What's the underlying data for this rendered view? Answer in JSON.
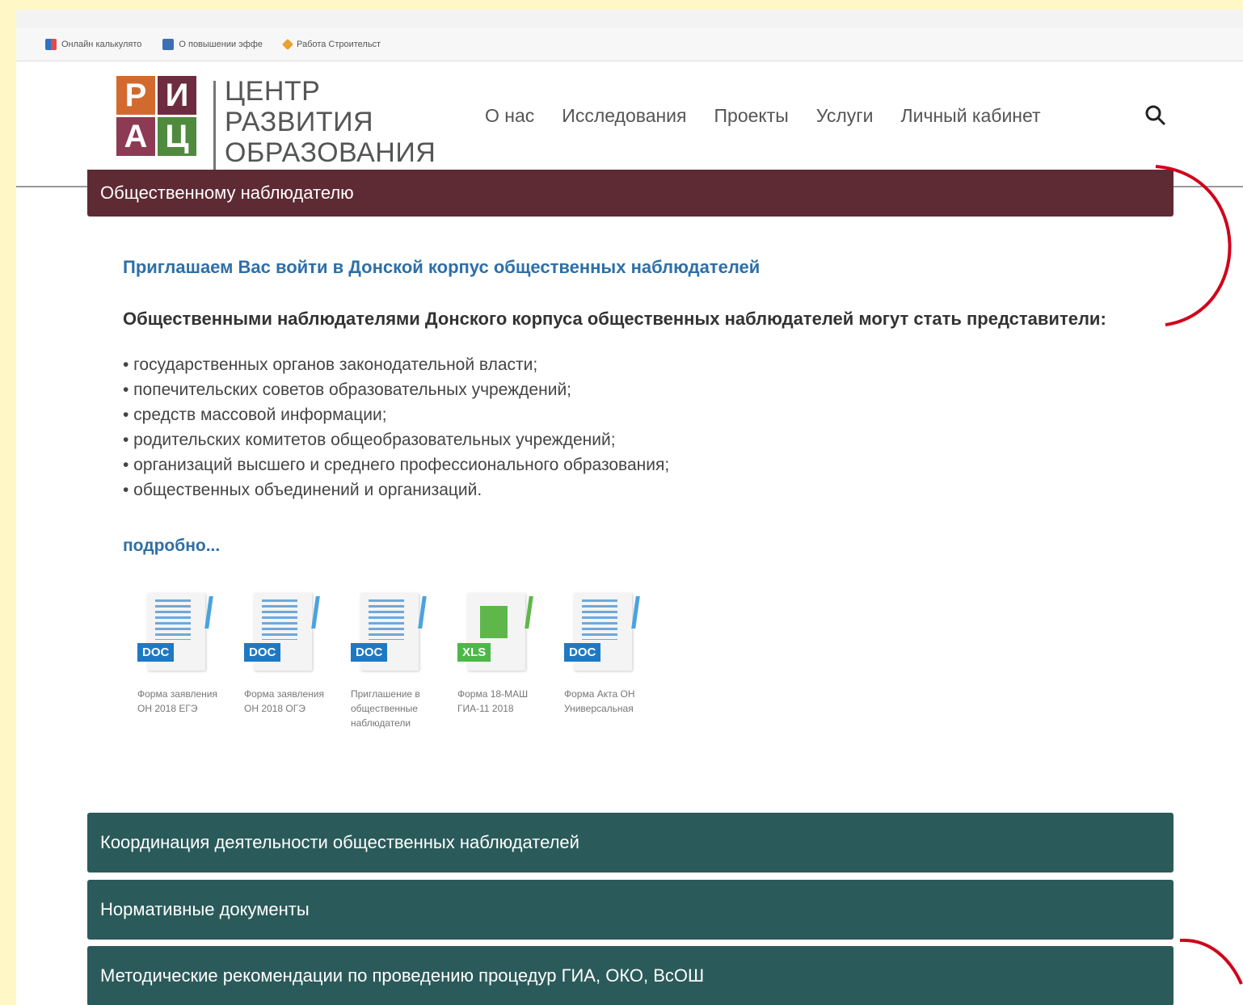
{
  "bookmarks": [
    {
      "label": "Онлайн калькулято",
      "icon": "calculator-icon"
    },
    {
      "label": "О повышении эффе",
      "icon": "document-icon"
    },
    {
      "label": "Работа Строительст",
      "icon": "tools-icon"
    }
  ],
  "logo": {
    "l1": "Р",
    "l2": "И",
    "l3": "А",
    "l4": "Ц",
    "text1": "ЦЕНТР",
    "text2": "РАЗВИТИЯ",
    "text3": "ОБРАЗОВАНИЯ"
  },
  "nav": [
    "О нас",
    "Исследования",
    "Проекты",
    "Услуги",
    "Личный кабинет"
  ],
  "panels": {
    "active": "Общественному наблюдателю",
    "closed": [
      "Координация деятельности общественных наблюдателей",
      "Нормативные документы",
      "Методические рекомендации по проведению процедур ГИА, ОКО, ВсОШ"
    ]
  },
  "content": {
    "invite": "Приглашаем Вас войти в Донской корпус общественных наблюдателей",
    "lead": "Общественными наблюдателями Донского корпуса общественных наблюдателей   могут стать представители:",
    "list": [
      "• государственных органов законодательной власти;",
      "• попечительских советов образовательных учреждений;",
      "• средств массовой информации;",
      "• родительских комитетов общеобразовательных учреждений;",
      "• организаций высшего и среднего профессионального образования;",
      "• общественных объединений и организаций."
    ],
    "more": "подробно..."
  },
  "files": [
    {
      "type": "DOC",
      "name": "Форма заявления ОН 2018 ЕГЭ"
    },
    {
      "type": "DOC",
      "name": "Форма заявления ОН 2018 ОГЭ"
    },
    {
      "type": "DOC",
      "name": "Приглашение в общественные наблюдатели"
    },
    {
      "type": "XLS",
      "name": "Форма 18-МАШ ГИА-11 2018"
    },
    {
      "type": "DOC",
      "name": "Форма Акта ОН Универсальная"
    }
  ],
  "colors": {
    "active_panel": "#5e2a33",
    "closed_panel": "#2b5a5a",
    "link": "#2e6fa8",
    "annotation": "#d0021b"
  }
}
